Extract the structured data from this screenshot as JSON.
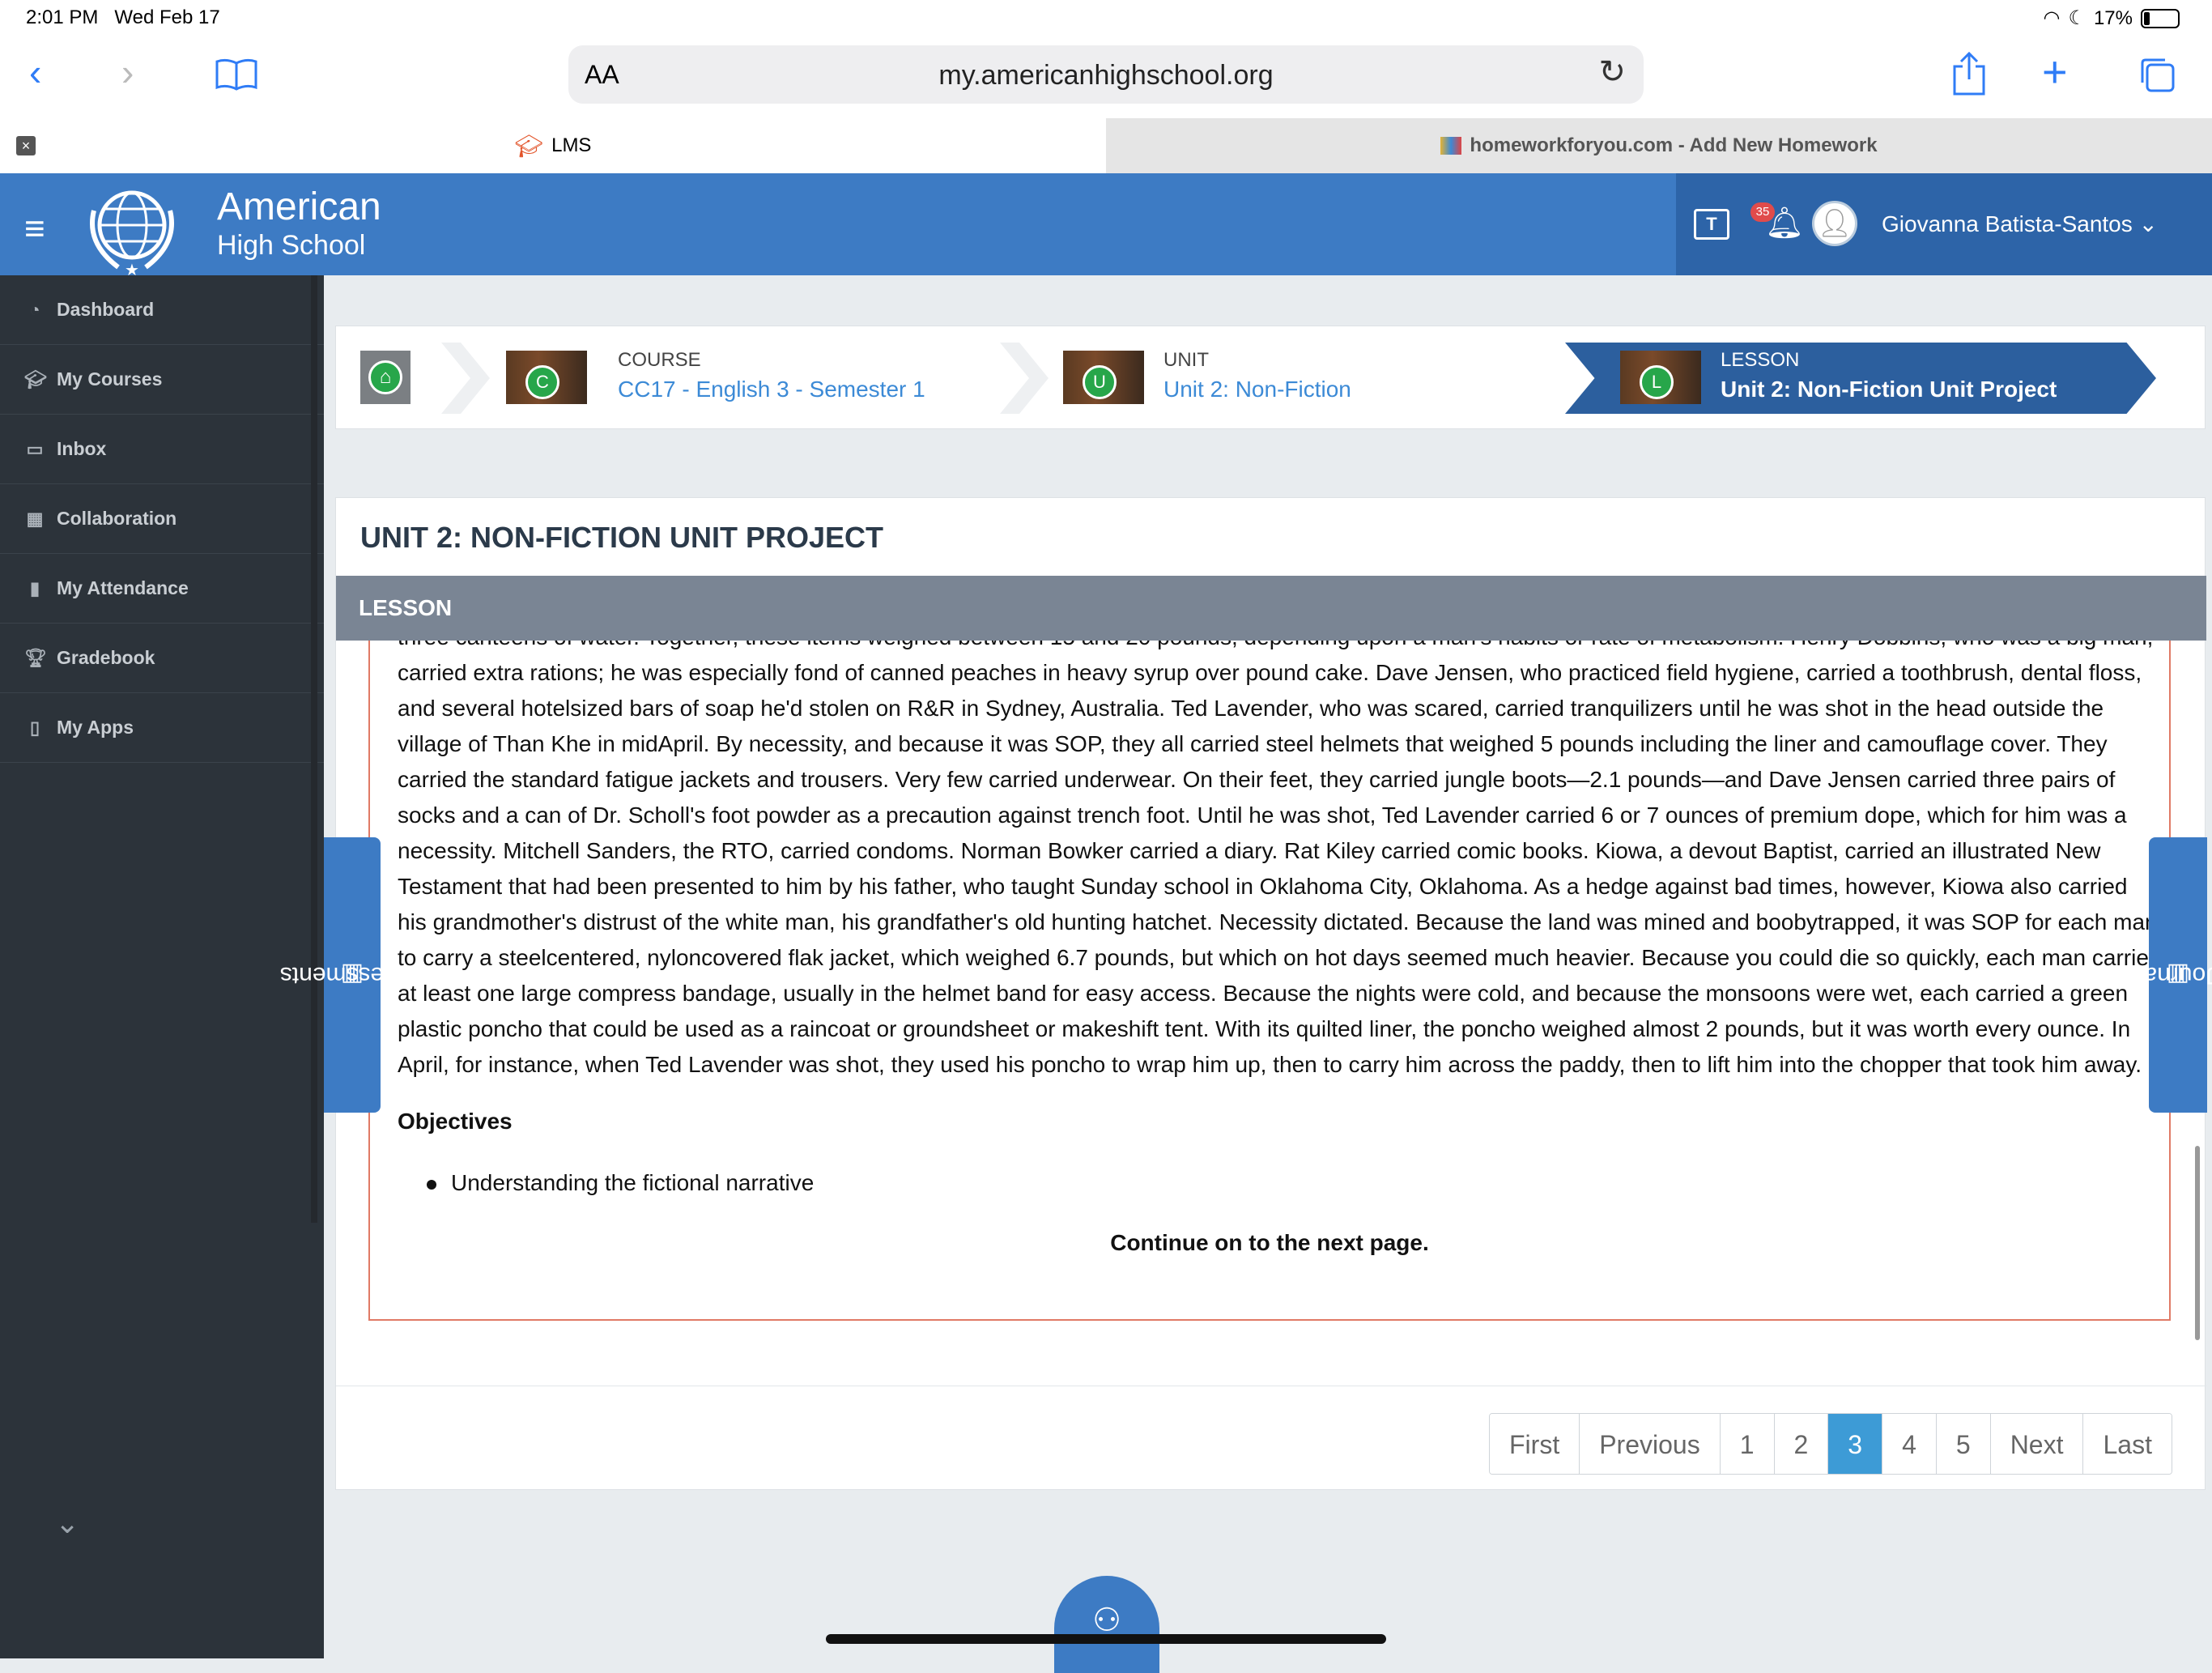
{
  "status_bar": {
    "time": "2:01 PM",
    "date": "Wed Feb 17",
    "battery": "17%"
  },
  "browser": {
    "aa_label": "AA",
    "url": "my.americanhighschool.org",
    "tabs": [
      {
        "label": "LMS",
        "active": true
      },
      {
        "label": "homeworkforyou.com - Add New Homework",
        "active": false
      }
    ]
  },
  "header": {
    "brand_line1": "American",
    "brand_line2": "High School",
    "teams_label": "T",
    "notification_count": "35",
    "user_name": "Giovanna Batista-Santos"
  },
  "sidebar": {
    "items": [
      {
        "label": "Dashboard",
        "icon": "dashboard-icon"
      },
      {
        "label": "My Courses",
        "icon": "graduation-cap-icon"
      },
      {
        "label": "Inbox",
        "icon": "inbox-icon"
      },
      {
        "label": "Collaboration",
        "icon": "teams-icon"
      },
      {
        "label": "My Attendance",
        "icon": "clipboard-icon"
      },
      {
        "label": "Gradebook",
        "icon": "trophy-icon"
      },
      {
        "label": "My Apps",
        "icon": "mobile-icon"
      }
    ]
  },
  "breadcrumb": {
    "course": {
      "badge": "C",
      "label": "COURSE",
      "title": "CC17 - English 3 - Semester 1"
    },
    "unit": {
      "badge": "U",
      "label": "UNIT",
      "title": "Unit 2: Non-Fiction"
    },
    "lesson": {
      "badge": "L",
      "label": "LESSON",
      "title": "Unit 2: Non-Fiction Unit Project"
    }
  },
  "card": {
    "title": "UNIT 2: NON-FICTION UNIT PROJECT",
    "section": "LESSON",
    "paragraph": "three canteens of water. Together, these items weighed between 15 and 20 pounds, depending upon a man's habits or rate of metabolism. Henry Dobbins, who was a big man, carried extra rations; he was especially fond of canned peaches in heavy syrup over pound cake. Dave Jensen, who practiced field hygiene, carried a toothbrush, dental floss, and several hotelsized bars of soap he'd stolen on R&R in Sydney, Australia. Ted Lavender, who was scared, carried tranquilizers until he was shot in the head outside the village of Than Khe in midApril. By necessity, and because it was SOP, they all carried steel helmets that weighed 5 pounds including the liner and camouflage cover. They carried the standard fatigue jackets and trousers. Very few carried underwear. On their feet, they carried jungle boots—2.1 pounds—and Dave Jensen carried three pairs of socks and a can of Dr. Scholl's foot powder as a precaution against trench foot. Until he was shot, Ted Lavender carried 6 or 7 ounces of premium dope, which for him was a necessity. Mitchell Sanders, the RTO, carried condoms. Norman Bowker carried a diary. Rat Kiley carried comic books. Kiowa, a devout Baptist, carried an illustrated New Testament that had been presented to him by his father, who taught Sunday school in Oklahoma City, Oklahoma. As a hedge against bad times, however, Kiowa also carried his grandmother's distrust of the white man, his grandfather's old hunting hatchet. Necessity dictated. Because the land was mined and boobytrapped, it was SOP for each man to carry a steelcentered, nyloncovered flak jacket, which weighed 6.7 pounds, but which on hot days seemed much heavier. Because you could die so quickly, each man carried at least one large compress bandage, usually in the helmet band for easy access. Because the nights were cold, and because the monsoons were wet, each carried a green plastic poncho that could be used as a raincoat or groundsheet or makeshift tent. With its quilted liner, the poncho weighed almost 2 pounds, but it was worth every ounce. In April, for instance, when Ted Lavender was shot, they used his poncho to wrap him up, then to carry him across the paddy, then to lift him into the chopper that took him away.",
    "objectives_heading": "Objectives",
    "objectives": [
      "Understanding the fictional narrative"
    ],
    "continue_text": "Continue on to the next page."
  },
  "pagination": {
    "first": "First",
    "previous": "Previous",
    "pages": [
      "1",
      "2",
      "3",
      "4",
      "5"
    ],
    "current": "3",
    "next": "Next",
    "last": "Last"
  },
  "side_tabs": {
    "left": "Assessments",
    "right": "Journal"
  },
  "colors": {
    "brand_blue": "#3d7bc4",
    "sidebar": "#2c333a",
    "active_crumb": "#2c5f9e",
    "active_page": "#3d9bd6"
  }
}
